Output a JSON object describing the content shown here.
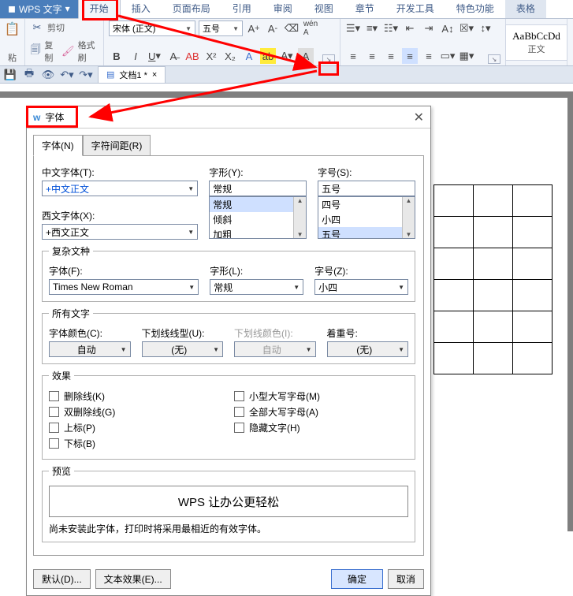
{
  "app": {
    "name": "WPS 文字",
    "menu_tri": "▾"
  },
  "tabs": [
    "开始",
    "插入",
    "页面布局",
    "引用",
    "审阅",
    "视图",
    "章节",
    "开发工具",
    "特色功能",
    "表格"
  ],
  "clip": {
    "cut": "剪切",
    "copy": "复制",
    "brush": "格式刷",
    "paste": "粘"
  },
  "font": {
    "name": "宋体 (正文)",
    "size": "五号"
  },
  "style": {
    "sample": "AaBbCcDd",
    "label": "正文"
  },
  "qat": {
    "doc": "文档1 *"
  },
  "dlg": {
    "title": "字体",
    "tab_font": "字体(N)",
    "tab_space": "字符间距(R)",
    "cn_label": "中文字体(T):",
    "cn_val": "+中文正文",
    "en_label": "西文字体(X):",
    "en_val": "+西文正文",
    "style_label": "字形(Y):",
    "style_val": "常规",
    "style_opts": [
      "常规",
      "倾斜",
      "加粗"
    ],
    "size_label": "字号(S):",
    "size_val": "五号",
    "size_opts": [
      "四号",
      "小四",
      "五号"
    ],
    "complex_legend": "复杂文种",
    "cx_font_label": "字体(F):",
    "cx_font_val": "Times New Roman",
    "cx_style_label": "字形(L):",
    "cx_style_val": "常规",
    "cx_size_label": "字号(Z):",
    "cx_size_val": "小四",
    "all_legend": "所有文字",
    "color_label": "字体颜色(C):",
    "color_val": "自动",
    "ul_label": "下划线线型(U):",
    "ul_val": "(无)",
    "ulc_label": "下划线颜色(I):",
    "ulc_val": "自动",
    "em_label": "着重号:",
    "em_val": "(无)",
    "fx_legend": "效果",
    "fx": [
      "删除线(K)",
      "双删除线(G)",
      "上标(P)",
      "下标(B)",
      "小型大写字母(M)",
      "全部大写字母(A)",
      "隐藏文字(H)"
    ],
    "pv_legend": "预览",
    "pv_text": "WPS 让办公更轻松",
    "note": "尚未安装此字体，打印时将采用最相近的有效字体。",
    "btn_default": "默认(D)...",
    "btn_txtfx": "文本效果(E)...",
    "btn_ok": "确定",
    "btn_cancel": "取消"
  }
}
